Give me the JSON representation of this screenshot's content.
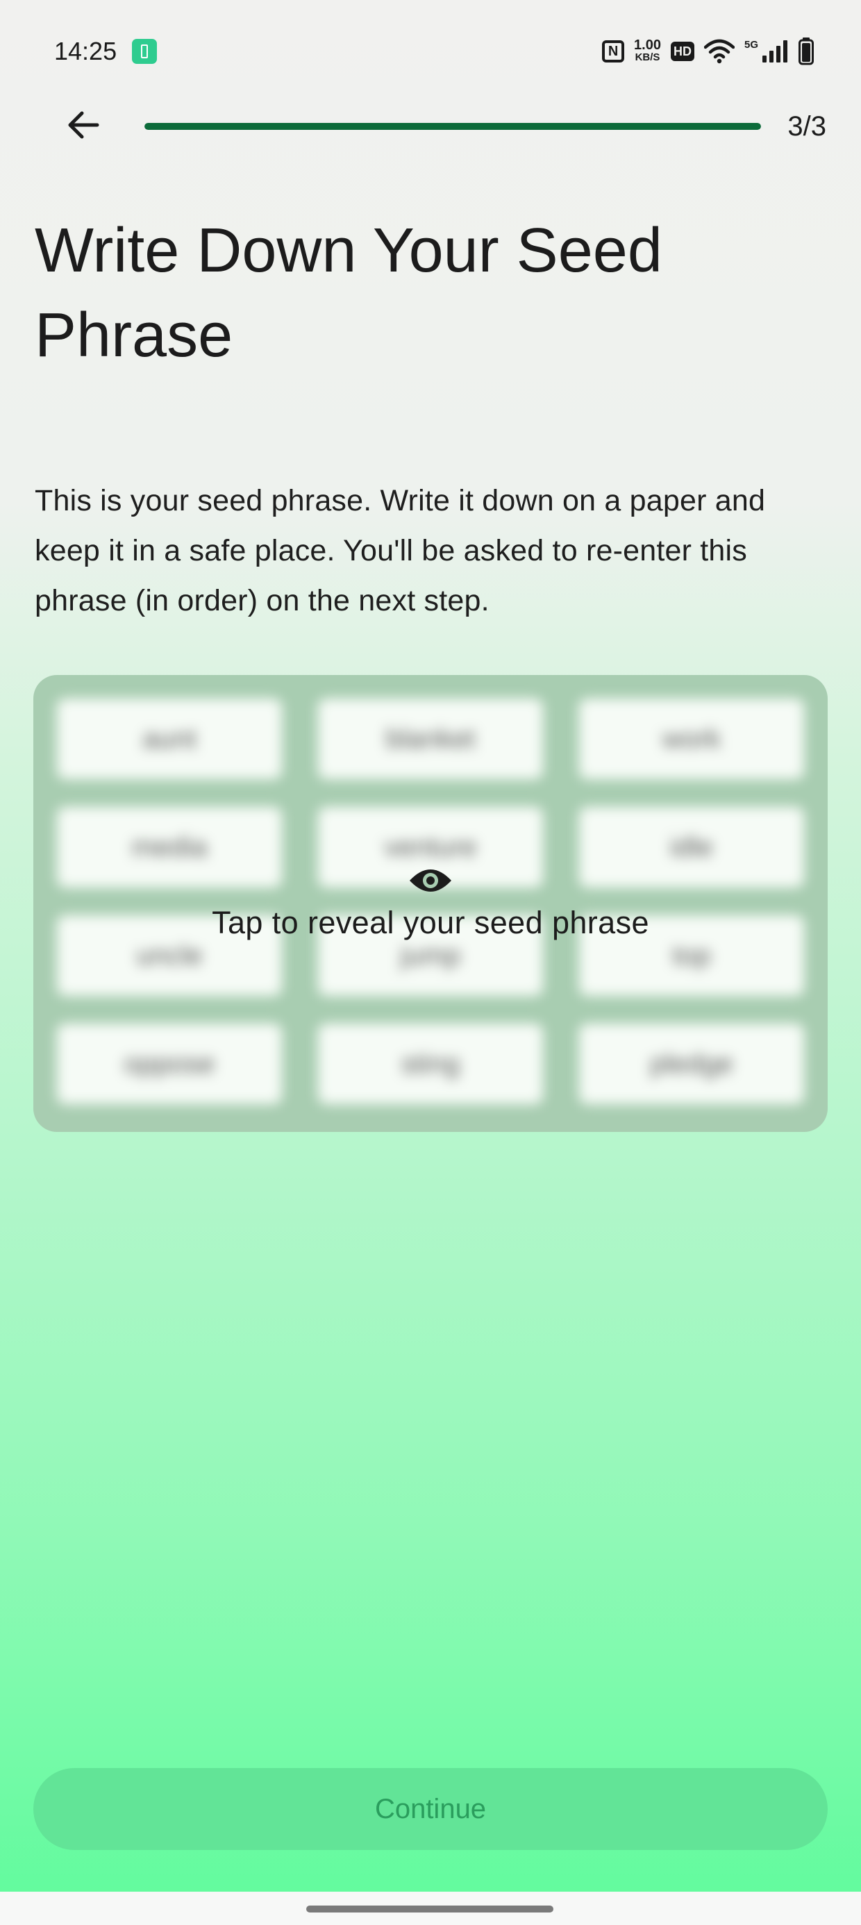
{
  "status_bar": {
    "time": "14:25",
    "nfc_label": "N",
    "net_speed_value": "1.00",
    "net_speed_unit": "KB/S",
    "hd_label": "HD",
    "signal_label": "5G"
  },
  "header": {
    "step_label": "3/3",
    "progress_fraction": 1.0
  },
  "content": {
    "title": "Write Down Your Seed Phrase",
    "description": "This is your seed phrase. Write it down on a paper and keep it in a safe place. You'll be asked to re-enter this phrase (in order) on the next step."
  },
  "seed_card": {
    "reveal_label": "Tap to reveal your seed phrase",
    "words": [
      "aunt",
      "blanket",
      "work",
      "media",
      "venture",
      "idle",
      "uncle",
      "jump",
      "top",
      "oppose",
      "sting",
      "pledge"
    ],
    "blurred": true
  },
  "footer": {
    "continue_label": "Continue",
    "continue_enabled": false
  },
  "colors": {
    "progress": "#0c6b3a",
    "card": "#a8cdb1",
    "button": "#62e497",
    "button_text": "#2a9d5d"
  },
  "icons": [
    "battery-saver-icon",
    "nfc-icon",
    "hd-icon",
    "wifi-icon",
    "cellular-signal-icon",
    "battery-icon",
    "back-arrow-icon",
    "eye-icon"
  ]
}
